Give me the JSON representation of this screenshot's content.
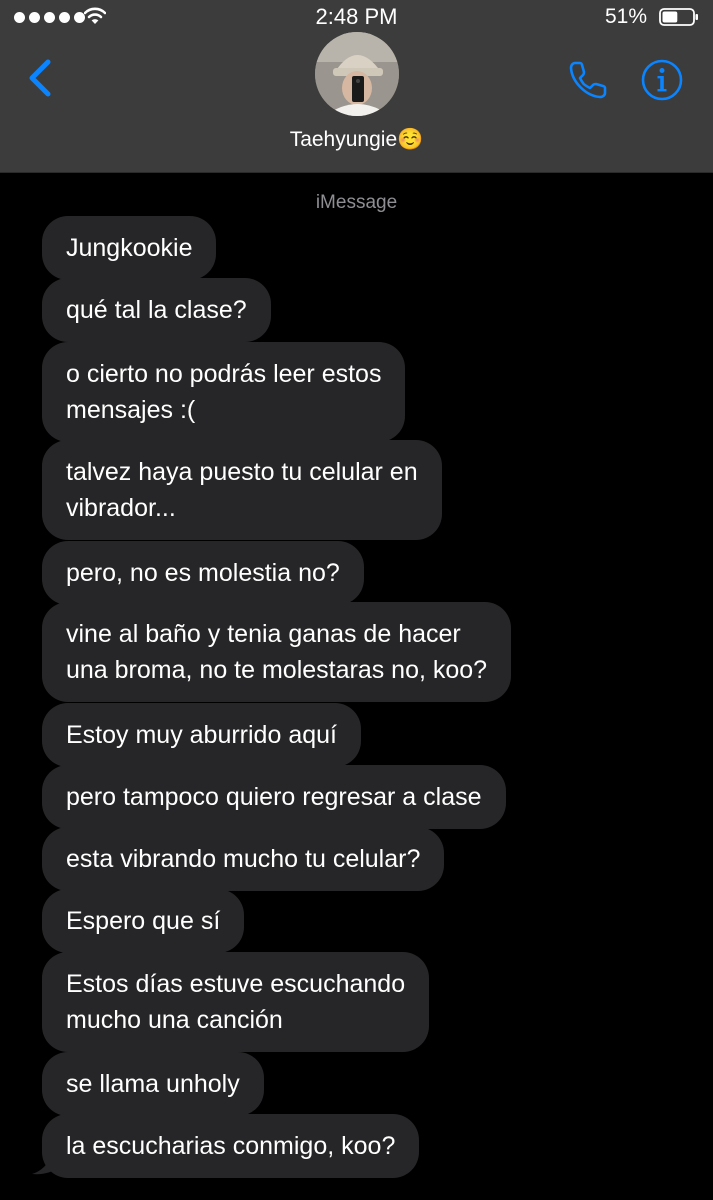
{
  "status_bar": {
    "time": "2:48 PM",
    "battery_percent": "51%",
    "battery_level": 0.51
  },
  "header": {
    "contact_name": "Taehyungie☺️"
  },
  "service_label": "iMessage",
  "messages": [
    {
      "text": "Jungkookie"
    },
    {
      "text": "qué tal la clase?"
    },
    {
      "text": "o cierto no podrás leer estos\nmensajes :("
    },
    {
      "text": "talvez haya puesto tu celular en\nvibrador..."
    },
    {
      "text": "pero, no es molestia no?"
    },
    {
      "text": "vine al baño y tenia ganas de hacer\nuna broma, no te molestaras no, koo?"
    },
    {
      "text": "Estoy muy aburrido aquí"
    },
    {
      "text": "pero tampoco quiero regresar a clase"
    },
    {
      "text": "esta vibrando mucho tu celular?"
    },
    {
      "text": "Espero que sí"
    },
    {
      "text": "Estos días estuve escuchando\nmucho una canción"
    },
    {
      "text": "se llama unholy"
    },
    {
      "text": "la escucharias conmigo, koo?"
    }
  ],
  "colors": {
    "accent": "#0a84ff",
    "bubble": "#262628",
    "header_bg": "#3c3c3c"
  }
}
